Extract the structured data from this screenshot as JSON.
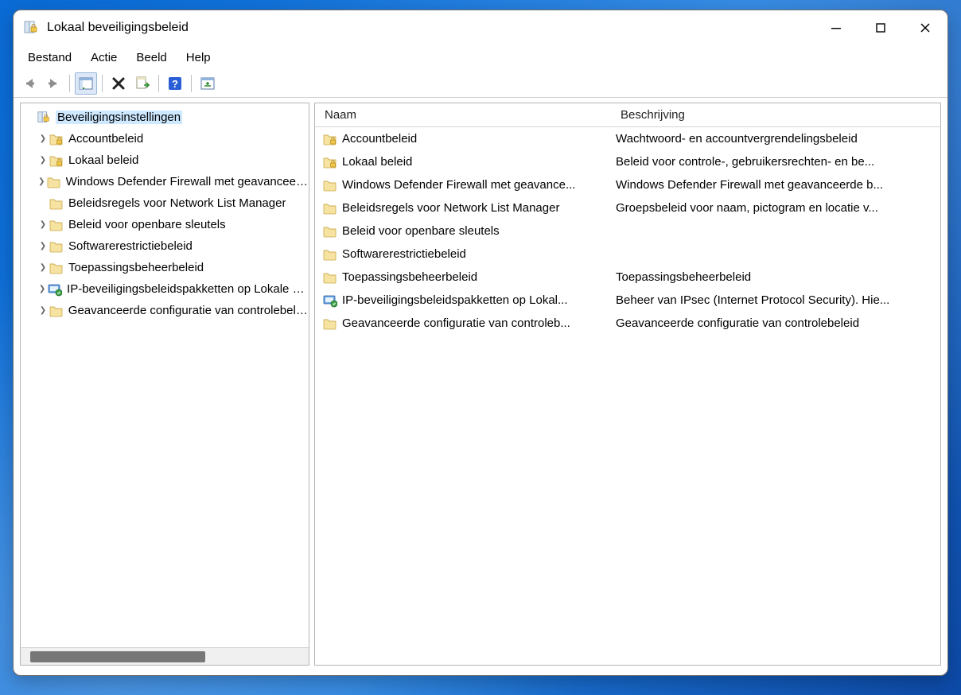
{
  "window": {
    "title": "Lokaal beveiligingsbeleid"
  },
  "menu": {
    "items": [
      "Bestand",
      "Actie",
      "Beeld",
      "Help"
    ]
  },
  "tree": {
    "root": "Beveiligingsinstellingen",
    "items": [
      {
        "label": "Accountbeleid",
        "expandable": true,
        "icon": "folder-lock"
      },
      {
        "label": "Lokaal beleid",
        "expandable": true,
        "icon": "folder-lock"
      },
      {
        "label": "Windows Defender Firewall met geavanceerde beveiliging",
        "expandable": true,
        "icon": "folder"
      },
      {
        "label": "Beleidsregels voor Network List Manager",
        "expandable": false,
        "icon": "folder"
      },
      {
        "label": "Beleid voor openbare sleutels",
        "expandable": true,
        "icon": "folder"
      },
      {
        "label": "Softwarerestrictiebeleid",
        "expandable": true,
        "icon": "folder"
      },
      {
        "label": "Toepassingsbeheerbeleid",
        "expandable": true,
        "icon": "folder"
      },
      {
        "label": "IP-beveiligingsbeleidspakketten op Lokale computer",
        "expandable": true,
        "icon": "ipsec"
      },
      {
        "label": "Geavanceerde configuratie van controlebeleid",
        "expandable": true,
        "icon": "folder"
      }
    ]
  },
  "list": {
    "columns": {
      "name": "Naam",
      "desc": "Beschrijving"
    },
    "rows": [
      {
        "name": "Accountbeleid",
        "desc": "Wachtwoord- en accountvergrendelingsbeleid",
        "icon": "folder-lock"
      },
      {
        "name": "Lokaal beleid",
        "desc": "Beleid voor controle-, gebruikersrechten- en be...",
        "icon": "folder-lock"
      },
      {
        "name": "Windows Defender Firewall met geavance...",
        "desc": "Windows Defender Firewall met geavanceerde b...",
        "icon": "folder"
      },
      {
        "name": "Beleidsregels voor Network List Manager",
        "desc": "Groepsbeleid voor naam, pictogram en locatie v...",
        "icon": "folder"
      },
      {
        "name": "Beleid voor openbare sleutels",
        "desc": "",
        "icon": "folder"
      },
      {
        "name": "Softwarerestrictiebeleid",
        "desc": "",
        "icon": "folder"
      },
      {
        "name": "Toepassingsbeheerbeleid",
        "desc": "Toepassingsbeheerbeleid",
        "icon": "folder"
      },
      {
        "name": "IP-beveiligingsbeleidspakketten op Lokal...",
        "desc": "Beheer van IPsec (Internet Protocol Security). Hie...",
        "icon": "ipsec"
      },
      {
        "name": "Geavanceerde configuratie van controleb...",
        "desc": "Geavanceerde configuratie van controlebeleid",
        "icon": "folder"
      }
    ]
  }
}
